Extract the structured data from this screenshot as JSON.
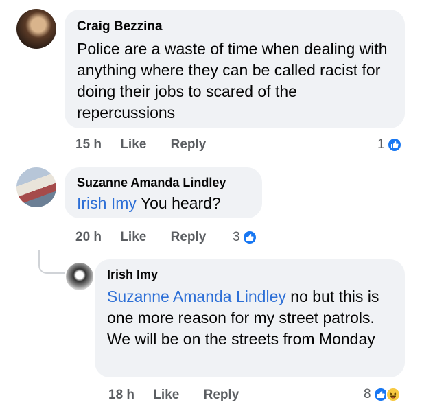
{
  "comments": [
    {
      "author": "Craig Bezzina",
      "text": "Police are a waste of time when dealing with anything where they can be called racist for doing their jobs to scared of the repercussions",
      "time": "15 h",
      "like_label": "Like",
      "reply_label": "Reply",
      "reaction_count": "1",
      "reactions": [
        "like-icon"
      ]
    },
    {
      "author": "Suzanne Amanda Lindley",
      "mention": "Irish Imy",
      "text": " You heard?",
      "time": "20 h",
      "like_label": "Like",
      "reply_label": "Reply",
      "reaction_count": "3",
      "reactions": [
        "like-icon"
      ]
    },
    {
      "author": "Irish Imy",
      "mention": "Suzanne Amanda Lindley",
      "text": " no but this is one more reason for my street patrols. We will be on the streets from Monday",
      "time": "18 h",
      "like_label": "Like",
      "reply_label": "Reply",
      "reaction_count": "8",
      "reactions": [
        "like-icon",
        "haha-icon"
      ]
    }
  ],
  "colors": {
    "bubble": "#f0f2f5",
    "mention": "#2d6fd6",
    "like": "#1877f2",
    "meta": "#5b5e62"
  }
}
